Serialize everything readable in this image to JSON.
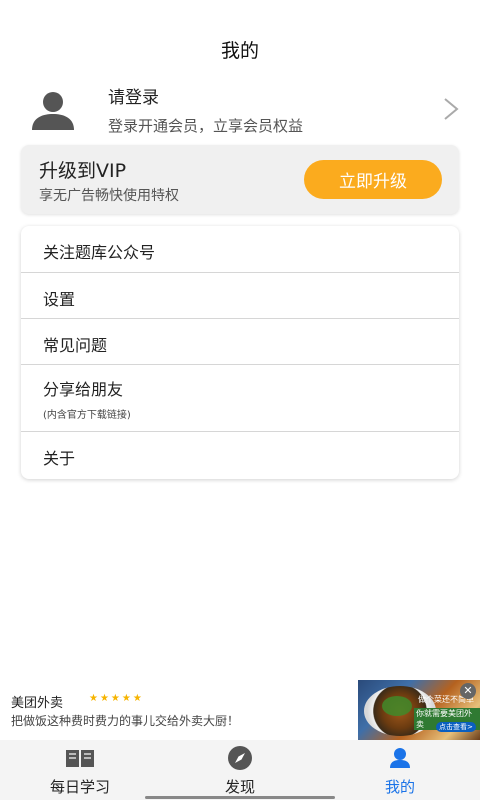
{
  "header": {
    "title": "我的"
  },
  "profile": {
    "name": "请登录",
    "subtitle": "登录开通会员，立享会员权益",
    "icons": {
      "avatar": "user-avatar-icon",
      "chevron": "chevron-right-icon"
    }
  },
  "vip": {
    "title": "升级到VIP",
    "subtitle": "享无广告畅快使用特权",
    "button_label": "立即升级",
    "accent_color": "#fbab1e"
  },
  "menu": {
    "items": [
      {
        "label": "关注题库公众号",
        "note": ""
      },
      {
        "label": "设置",
        "note": ""
      },
      {
        "label": "常见问题",
        "note": ""
      },
      {
        "label": "分享给朋友",
        "note": "(内含官方下载链接)"
      },
      {
        "label": "关于",
        "note": ""
      }
    ]
  },
  "ad": {
    "title": "美团外卖",
    "stars": "★★★★★",
    "description": "把做饭这种费时费力的事儿交给外卖大厨！",
    "image_caption_1": "做个菜还不简单",
    "image_caption_2": "你就需要美团外卖",
    "image_button": "点击查看>"
  },
  "bottom_nav": {
    "items": [
      {
        "label": "每日学习",
        "icon": "book-icon",
        "active": false
      },
      {
        "label": "发现",
        "icon": "compass-icon",
        "active": false
      },
      {
        "label": "我的",
        "icon": "person-icon",
        "active": true
      }
    ],
    "active_color": "#1a73e8"
  }
}
